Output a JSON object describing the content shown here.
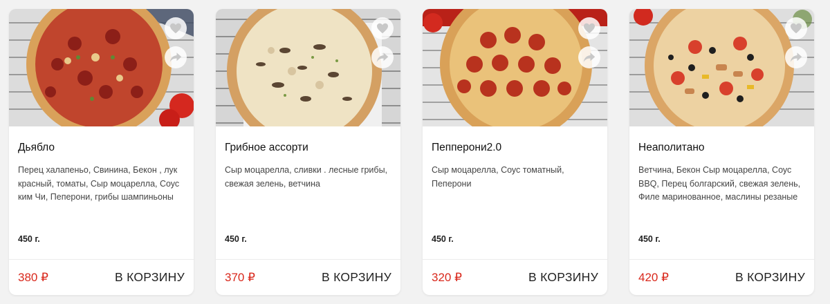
{
  "products": [
    {
      "name": "Дьябло",
      "description": "Перец халапеньо, Свинина, Бекон , лук красный, томаты, Сыр моцарелла, Соус ким Чи, Пеперони, грибы шампиньоны",
      "weight": "450 г.",
      "price": "380 ₽",
      "cart_label": "В КОРЗИНУ"
    },
    {
      "name": "Грибное ассорти",
      "description": "Сыр моцарелла, сливки . лесные грибы, свежая зелень, ветчина",
      "weight": "450 г.",
      "price": "370 ₽",
      "cart_label": "В КОРЗИНУ"
    },
    {
      "name": "Пепперони2.0",
      "description": "Сыр моцарелла, Соус томатный, Пеперони",
      "weight": "450 г.",
      "price": "320 ₽",
      "cart_label": "В КОРЗИНУ"
    },
    {
      "name": "Неаполитано",
      "description": "Ветчина, Бекон Сыр моцарелла, Соус BBQ, Перец болгарский, свежая зелень, Филе маринованное, маслины резаные",
      "weight": "450 г.",
      "price": "420 ₽",
      "cart_label": "В КОРЗИНУ"
    }
  ],
  "icons": {
    "favorite": "heart-icon",
    "share": "share-icon"
  },
  "colors": {
    "price": "#d9281c",
    "background": "#f2f2f2"
  }
}
